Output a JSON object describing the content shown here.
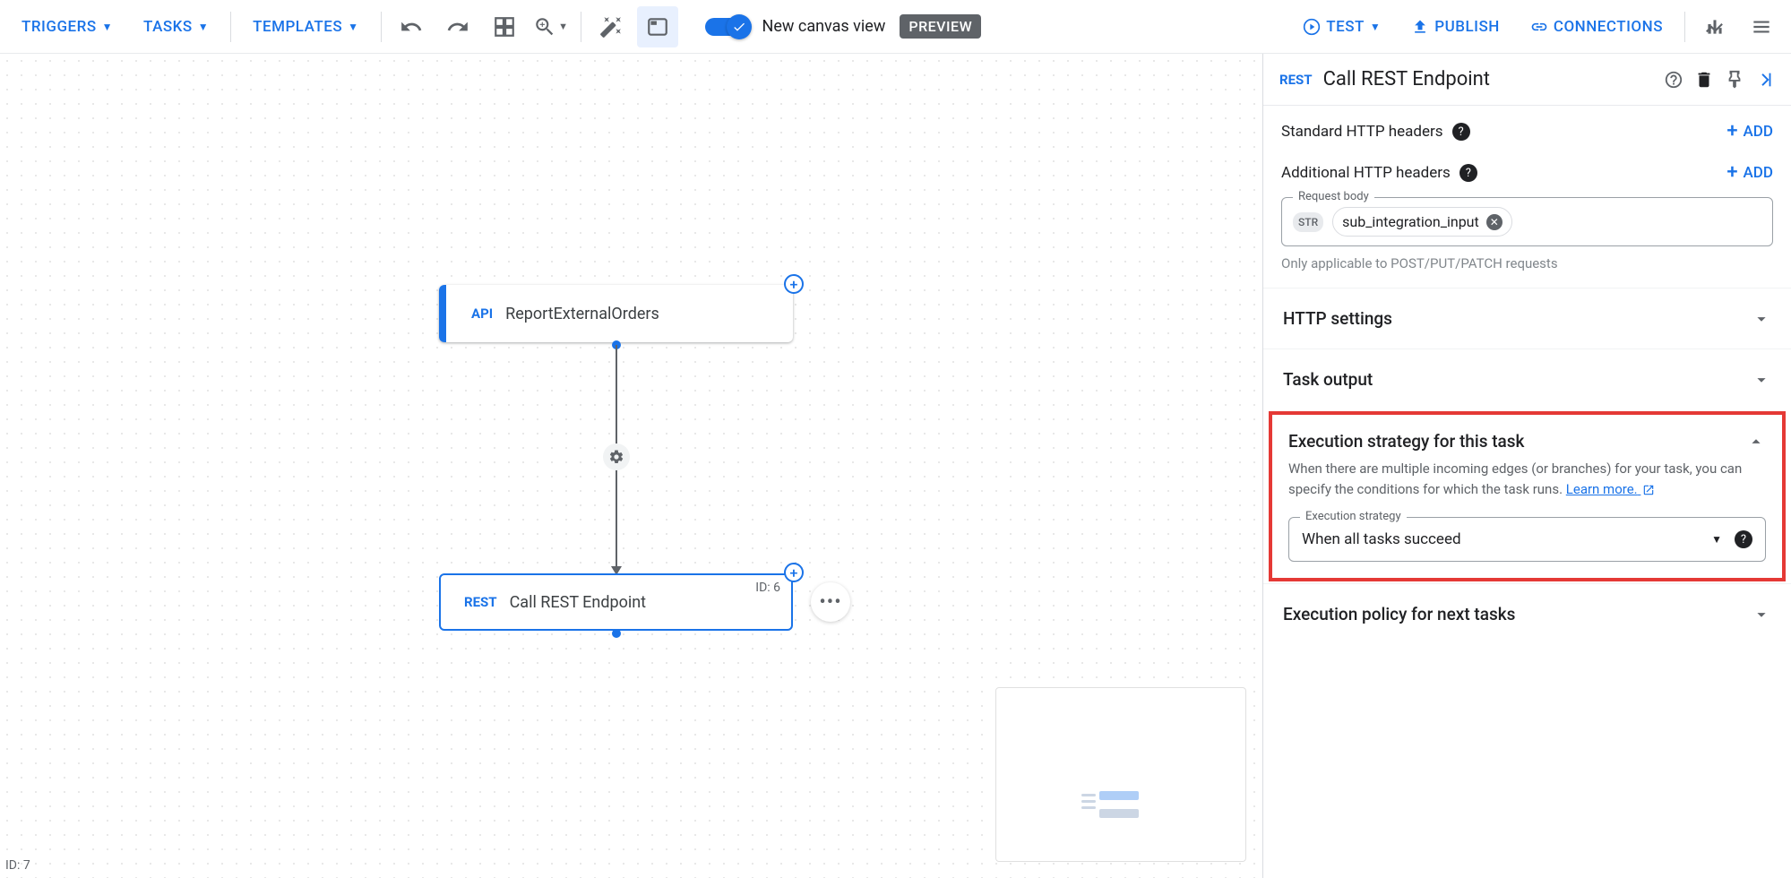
{
  "toolbar": {
    "triggers": "TRIGGERS",
    "tasks": "TASKS",
    "templates": "TEMPLATES",
    "canvas_label": "New canvas view",
    "preview_badge": "PREVIEW",
    "test": "TEST",
    "publish": "PUBLISH",
    "connections": "CONNECTIONS"
  },
  "canvas": {
    "node1_badge": "API",
    "node1_label": "ReportExternalOrders",
    "node2_badge": "REST",
    "node2_label": "Call REST Endpoint",
    "node2_id": "ID: 6",
    "bottom_left": "ID: 7"
  },
  "panel": {
    "header_badge": "REST",
    "header_title": "Call REST Endpoint",
    "std_headers": "Standard HTTP headers",
    "add_btn": "ADD",
    "addl_headers": "Additional HTTP headers",
    "request_body_legend": "Request body",
    "request_body_chip": "sub_integration_input",
    "str_pill": "STR",
    "request_body_hint": "Only applicable to POST/PUT/PATCH requests",
    "http_settings": "HTTP settings",
    "task_output": "Task output",
    "exec_strategy_title": "Execution strategy for this task",
    "exec_strategy_desc": "When there are multiple incoming edges (or branches) for your task, you can specify the conditions for which the task runs.",
    "learn_more": "Learn more.",
    "exec_strategy_legend": "Execution strategy",
    "exec_strategy_value": "When all tasks succeed",
    "exec_policy_title": "Execution policy for next tasks"
  }
}
